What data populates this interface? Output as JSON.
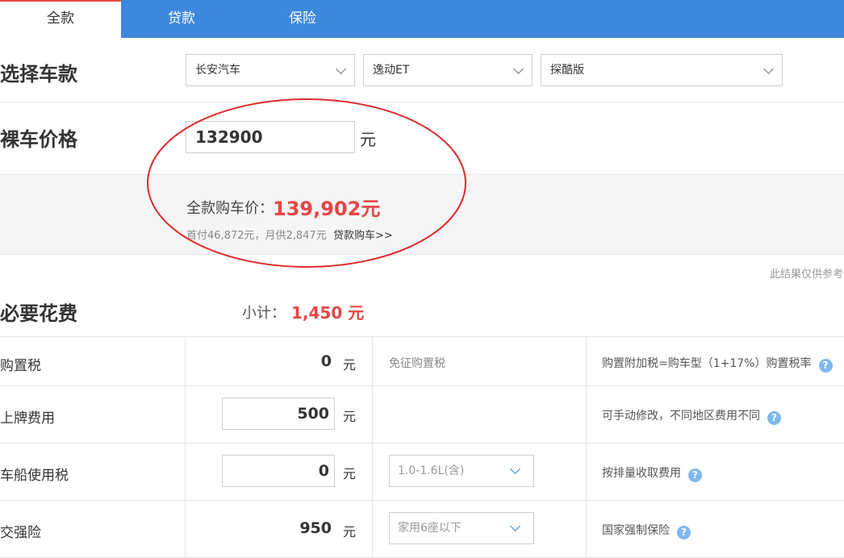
{
  "tabs": [
    {
      "label": "全款"
    },
    {
      "label": "贷款"
    },
    {
      "label": "保险"
    }
  ],
  "select_model": {
    "heading": "选择车款",
    "brand": "长安汽车",
    "series": "逸动ET",
    "trim": "探酷版"
  },
  "price": {
    "heading": "裸车价格",
    "value": "132900",
    "unit": "元"
  },
  "result": {
    "label": "全款购车价：",
    "value": "139,902元",
    "sub": "首付46,872元，月供2,847元",
    "loan_link": "贷款购车>>"
  },
  "disclaimer": "此结果仅供参考",
  "required_fees": {
    "heading": "必要花费",
    "subtotal_label": "小计：",
    "subtotal_value": "1,450 元"
  },
  "fees": [
    {
      "name": "购置税",
      "value": "0",
      "unit": "元",
      "note": "免征购置税",
      "desc": "购置附加税=购车型（1+17%）购置税率"
    },
    {
      "name": "上牌费用",
      "value": "500",
      "unit": "元",
      "desc": "可手动修改，不同地区费用不同"
    },
    {
      "name": "车船使用税",
      "value": "0",
      "unit": "元",
      "option": "1.0-1.6L(含)",
      "desc": "按排量收取费用"
    },
    {
      "name": "交强险",
      "value": "950",
      "unit": "元",
      "option": "家用6座以下",
      "desc": "国家强制保险"
    }
  ],
  "colors": {
    "tab_bar": "#3d87dc",
    "highlight_red": "#e84545",
    "annotation_circle": "#e02a2a"
  }
}
